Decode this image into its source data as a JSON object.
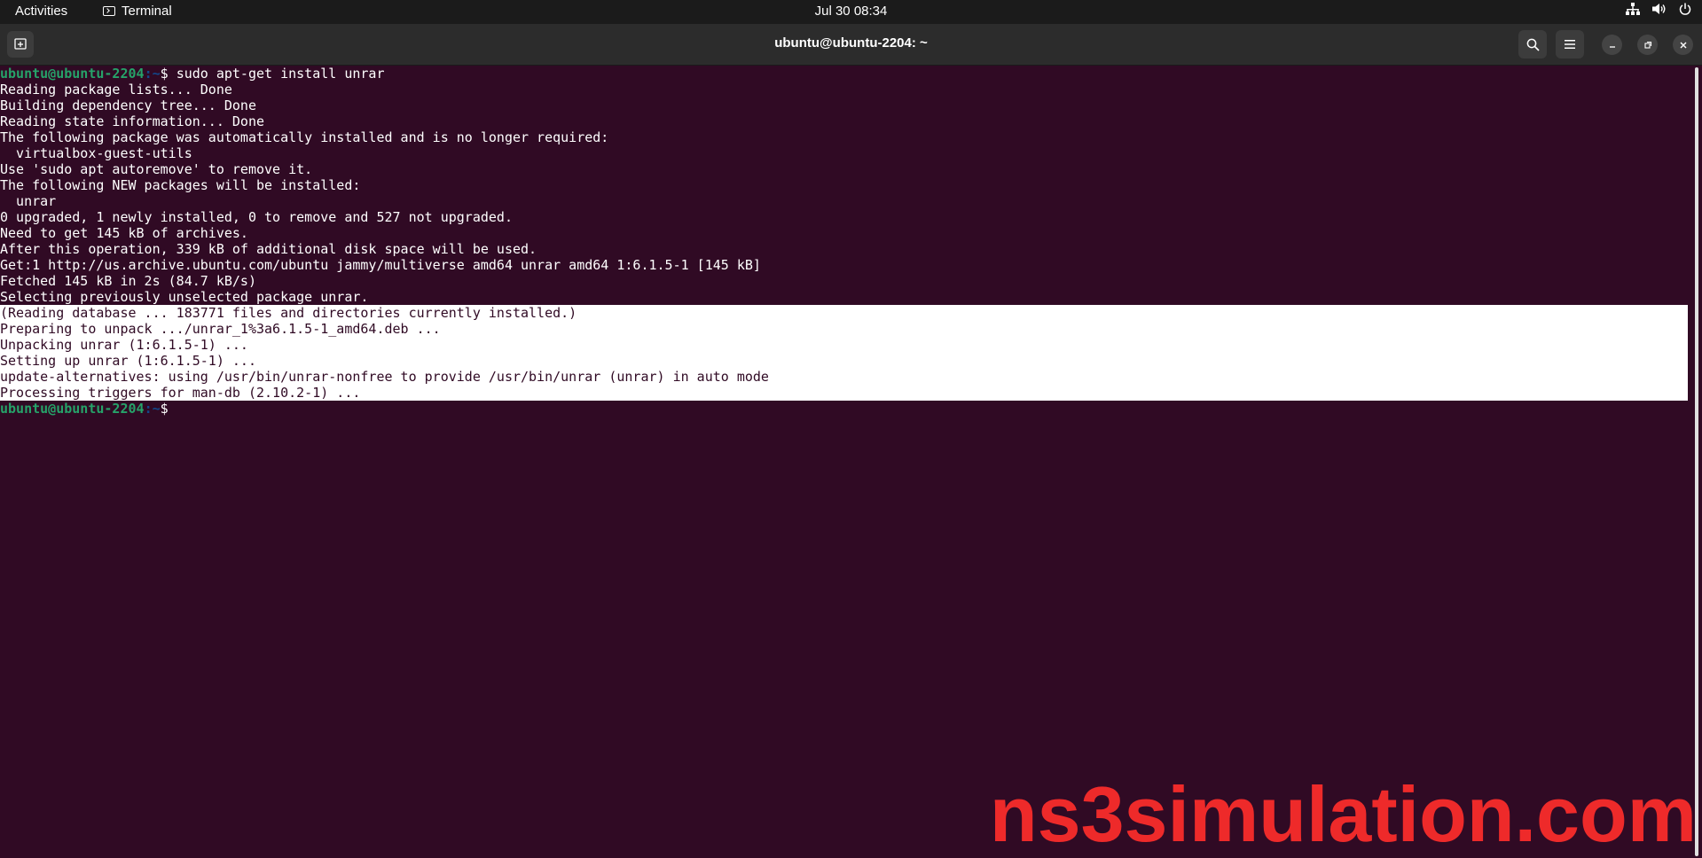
{
  "topbar": {
    "activities": "Activities",
    "app_name": "Terminal",
    "clock": "Jul 30  08:34"
  },
  "titlebar": {
    "title": "ubuntu@ubuntu-2204: ~"
  },
  "terminal": {
    "prompt_user": "ubuntu@ubuntu-2204",
    "prompt_path": ":~",
    "prompt_symbol": "$ ",
    "command": "sudo apt-get install unrar",
    "output": [
      "Reading package lists... Done",
      "Building dependency tree... Done",
      "Reading state information... Done",
      "The following package was automatically installed and is no longer required:",
      "  virtualbox-guest-utils",
      "Use 'sudo apt autoremove' to remove it.",
      "The following NEW packages will be installed:",
      "  unrar",
      "0 upgraded, 1 newly installed, 0 to remove and 527 not upgraded.",
      "Need to get 145 kB of archives.",
      "After this operation, 339 kB of additional disk space will be used.",
      "Get:1 http://us.archive.ubuntu.com/ubuntu jammy/multiverse amd64 unrar amd64 1:6.1.5-1 [145 kB]",
      "Fetched 145 kB in 2s (84.7 kB/s)",
      "Selecting previously unselected package unrar."
    ],
    "selected_output": [
      "(Reading database ... 183771 files and directories currently installed.)",
      "Preparing to unpack .../unrar_1%3a6.1.5-1_amd64.deb ...",
      "Unpacking unrar (1:6.1.5-1) ...",
      "Setting up unrar (1:6.1.5-1) ...",
      "update-alternatives: using /usr/bin/unrar-nonfree to provide /usr/bin/unrar (unrar) in auto mode",
      "Processing triggers for man-db (2.10.2-1) ..."
    ]
  },
  "watermark": "ns3simulation.com",
  "colors": {
    "terminal_bg": "#300a24",
    "prompt_user": "#26a269",
    "prompt_path": "#12488b",
    "selection_bg": "#ffffff",
    "watermark": "#ee2a2a"
  },
  "icons": {
    "tray": [
      "network-icon",
      "volume-icon",
      "power-icon"
    ],
    "titlebar": [
      "new-tab-icon",
      "search-icon",
      "menu-icon",
      "minimize-icon",
      "restore-icon",
      "close-icon"
    ]
  }
}
